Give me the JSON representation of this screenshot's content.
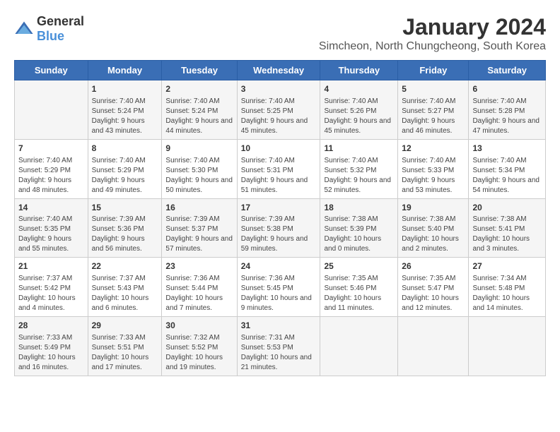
{
  "logo": {
    "general": "General",
    "blue": "Blue"
  },
  "header": {
    "title": "January 2024",
    "subtitle": "Simcheon, North Chungcheong, South Korea"
  },
  "weekdays": [
    "Sunday",
    "Monday",
    "Tuesday",
    "Wednesday",
    "Thursday",
    "Friday",
    "Saturday"
  ],
  "weeks": [
    [
      {
        "day": "",
        "sunrise": "",
        "sunset": "",
        "daylight": ""
      },
      {
        "day": "1",
        "sunrise": "Sunrise: 7:40 AM",
        "sunset": "Sunset: 5:24 PM",
        "daylight": "Daylight: 9 hours and 43 minutes."
      },
      {
        "day": "2",
        "sunrise": "Sunrise: 7:40 AM",
        "sunset": "Sunset: 5:24 PM",
        "daylight": "Daylight: 9 hours and 44 minutes."
      },
      {
        "day": "3",
        "sunrise": "Sunrise: 7:40 AM",
        "sunset": "Sunset: 5:25 PM",
        "daylight": "Daylight: 9 hours and 45 minutes."
      },
      {
        "day": "4",
        "sunrise": "Sunrise: 7:40 AM",
        "sunset": "Sunset: 5:26 PM",
        "daylight": "Daylight: 9 hours and 45 minutes."
      },
      {
        "day": "5",
        "sunrise": "Sunrise: 7:40 AM",
        "sunset": "Sunset: 5:27 PM",
        "daylight": "Daylight: 9 hours and 46 minutes."
      },
      {
        "day": "6",
        "sunrise": "Sunrise: 7:40 AM",
        "sunset": "Sunset: 5:28 PM",
        "daylight": "Daylight: 9 hours and 47 minutes."
      }
    ],
    [
      {
        "day": "7",
        "sunrise": "Sunrise: 7:40 AM",
        "sunset": "Sunset: 5:29 PM",
        "daylight": "Daylight: 9 hours and 48 minutes."
      },
      {
        "day": "8",
        "sunrise": "Sunrise: 7:40 AM",
        "sunset": "Sunset: 5:29 PM",
        "daylight": "Daylight: 9 hours and 49 minutes."
      },
      {
        "day": "9",
        "sunrise": "Sunrise: 7:40 AM",
        "sunset": "Sunset: 5:30 PM",
        "daylight": "Daylight: 9 hours and 50 minutes."
      },
      {
        "day": "10",
        "sunrise": "Sunrise: 7:40 AM",
        "sunset": "Sunset: 5:31 PM",
        "daylight": "Daylight: 9 hours and 51 minutes."
      },
      {
        "day": "11",
        "sunrise": "Sunrise: 7:40 AM",
        "sunset": "Sunset: 5:32 PM",
        "daylight": "Daylight: 9 hours and 52 minutes."
      },
      {
        "day": "12",
        "sunrise": "Sunrise: 7:40 AM",
        "sunset": "Sunset: 5:33 PM",
        "daylight": "Daylight: 9 hours and 53 minutes."
      },
      {
        "day": "13",
        "sunrise": "Sunrise: 7:40 AM",
        "sunset": "Sunset: 5:34 PM",
        "daylight": "Daylight: 9 hours and 54 minutes."
      }
    ],
    [
      {
        "day": "14",
        "sunrise": "Sunrise: 7:40 AM",
        "sunset": "Sunset: 5:35 PM",
        "daylight": "Daylight: 9 hours and 55 minutes."
      },
      {
        "day": "15",
        "sunrise": "Sunrise: 7:39 AM",
        "sunset": "Sunset: 5:36 PM",
        "daylight": "Daylight: 9 hours and 56 minutes."
      },
      {
        "day": "16",
        "sunrise": "Sunrise: 7:39 AM",
        "sunset": "Sunset: 5:37 PM",
        "daylight": "Daylight: 9 hours and 57 minutes."
      },
      {
        "day": "17",
        "sunrise": "Sunrise: 7:39 AM",
        "sunset": "Sunset: 5:38 PM",
        "daylight": "Daylight: 9 hours and 59 minutes."
      },
      {
        "day": "18",
        "sunrise": "Sunrise: 7:38 AM",
        "sunset": "Sunset: 5:39 PM",
        "daylight": "Daylight: 10 hours and 0 minutes."
      },
      {
        "day": "19",
        "sunrise": "Sunrise: 7:38 AM",
        "sunset": "Sunset: 5:40 PM",
        "daylight": "Daylight: 10 hours and 2 minutes."
      },
      {
        "day": "20",
        "sunrise": "Sunrise: 7:38 AM",
        "sunset": "Sunset: 5:41 PM",
        "daylight": "Daylight: 10 hours and 3 minutes."
      }
    ],
    [
      {
        "day": "21",
        "sunrise": "Sunrise: 7:37 AM",
        "sunset": "Sunset: 5:42 PM",
        "daylight": "Daylight: 10 hours and 4 minutes."
      },
      {
        "day": "22",
        "sunrise": "Sunrise: 7:37 AM",
        "sunset": "Sunset: 5:43 PM",
        "daylight": "Daylight: 10 hours and 6 minutes."
      },
      {
        "day": "23",
        "sunrise": "Sunrise: 7:36 AM",
        "sunset": "Sunset: 5:44 PM",
        "daylight": "Daylight: 10 hours and 7 minutes."
      },
      {
        "day": "24",
        "sunrise": "Sunrise: 7:36 AM",
        "sunset": "Sunset: 5:45 PM",
        "daylight": "Daylight: 10 hours and 9 minutes."
      },
      {
        "day": "25",
        "sunrise": "Sunrise: 7:35 AM",
        "sunset": "Sunset: 5:46 PM",
        "daylight": "Daylight: 10 hours and 11 minutes."
      },
      {
        "day": "26",
        "sunrise": "Sunrise: 7:35 AM",
        "sunset": "Sunset: 5:47 PM",
        "daylight": "Daylight: 10 hours and 12 minutes."
      },
      {
        "day": "27",
        "sunrise": "Sunrise: 7:34 AM",
        "sunset": "Sunset: 5:48 PM",
        "daylight": "Daylight: 10 hours and 14 minutes."
      }
    ],
    [
      {
        "day": "28",
        "sunrise": "Sunrise: 7:33 AM",
        "sunset": "Sunset: 5:49 PM",
        "daylight": "Daylight: 10 hours and 16 minutes."
      },
      {
        "day": "29",
        "sunrise": "Sunrise: 7:33 AM",
        "sunset": "Sunset: 5:51 PM",
        "daylight": "Daylight: 10 hours and 17 minutes."
      },
      {
        "day": "30",
        "sunrise": "Sunrise: 7:32 AM",
        "sunset": "Sunset: 5:52 PM",
        "daylight": "Daylight: 10 hours and 19 minutes."
      },
      {
        "day": "31",
        "sunrise": "Sunrise: 7:31 AM",
        "sunset": "Sunset: 5:53 PM",
        "daylight": "Daylight: 10 hours and 21 minutes."
      },
      {
        "day": "",
        "sunrise": "",
        "sunset": "",
        "daylight": ""
      },
      {
        "day": "",
        "sunrise": "",
        "sunset": "",
        "daylight": ""
      },
      {
        "day": "",
        "sunrise": "",
        "sunset": "",
        "daylight": ""
      }
    ]
  ]
}
